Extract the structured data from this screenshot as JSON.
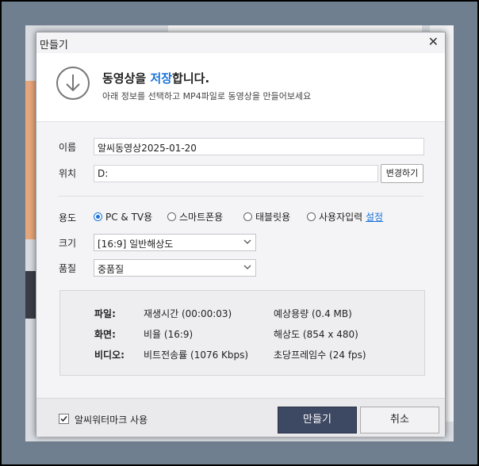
{
  "dialog": {
    "title": "만들기",
    "close": "✕"
  },
  "header": {
    "title_pre": "동영상을 ",
    "title_highlight": "저장",
    "title_post": "합니다.",
    "subtitle": "아래 정보를 선택하고 MP4파일로 동영상을 만들어보세요"
  },
  "form": {
    "name_label": "이름",
    "name_value": "알씨동영상2025-01-20",
    "location_label": "위치",
    "location_value": "D:",
    "change_button": "변경하기",
    "usage_label": "용도",
    "usage_options": [
      "PC & TV용",
      "스마트폰용",
      "태블릿용",
      "사용자입력"
    ],
    "usage_selected": 0,
    "settings_link": "설정",
    "size_label": "크기",
    "size_value": "[16:9] 일반해상도",
    "quality_label": "품질",
    "quality_value": "중품질"
  },
  "info": {
    "file_label": "파일:",
    "file_col1": "재생시간 (00:00:03)",
    "file_col2": "예상용량 (0.4 MB)",
    "screen_label": "화면:",
    "screen_col1": "비율 (16:9)",
    "screen_col2": "해상도 (854 x 480)",
    "video_label": "비디오:",
    "video_col1": "비트전송률 (1076 Kbps)",
    "video_col2": "초당프레임수 (24 fps)"
  },
  "footer": {
    "watermark_label": "알씨워터마크 사용",
    "watermark_checked": true,
    "create_button": "만들기",
    "cancel_button": "취소"
  },
  "colors": {
    "accent": "#1a73d9",
    "primary_button": "#3d4862"
  },
  "icons": {
    "header": "download-arrow-icon",
    "close": "close-icon",
    "dropdown": "chevron-down-icon",
    "checkbox": "check-icon"
  }
}
